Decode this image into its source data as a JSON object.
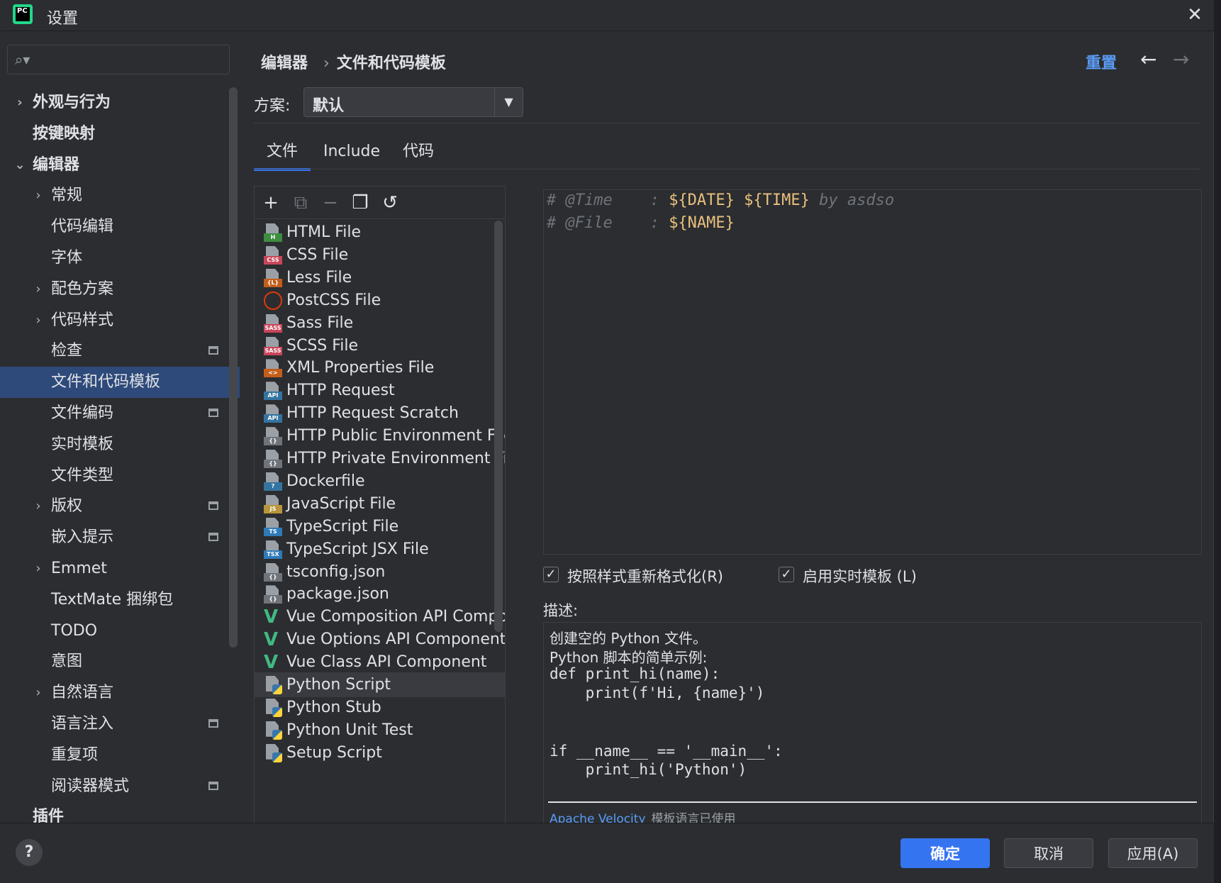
{
  "window": {
    "title": "设置",
    "logo_text": "PC"
  },
  "sidebar": {
    "items": [
      {
        "label": "外观与行为",
        "chevron": "›",
        "level": 0,
        "bold": true
      },
      {
        "label": "按键映射",
        "chevron": "",
        "level": 0,
        "bold": true
      },
      {
        "label": "编辑器",
        "chevron": "⌄",
        "level": 0,
        "bold": true
      },
      {
        "label": "常规",
        "chevron": "›",
        "level": 1
      },
      {
        "label": "代码编辑",
        "chevron": "",
        "level": 1
      },
      {
        "label": "字体",
        "chevron": "",
        "level": 1
      },
      {
        "label": "配色方案",
        "chevron": "›",
        "level": 1
      },
      {
        "label": "代码样式",
        "chevron": "›",
        "level": 1
      },
      {
        "label": "检查",
        "chevron": "",
        "level": 1,
        "proj": true
      },
      {
        "label": "文件和代码模板",
        "chevron": "",
        "level": 1,
        "selected": true
      },
      {
        "label": "文件编码",
        "chevron": "",
        "level": 1,
        "proj": true
      },
      {
        "label": "实时模板",
        "chevron": "",
        "level": 1
      },
      {
        "label": "文件类型",
        "chevron": "",
        "level": 1
      },
      {
        "label": "版权",
        "chevron": "›",
        "level": 1,
        "proj": true
      },
      {
        "label": "嵌入提示",
        "chevron": "",
        "level": 1,
        "proj": true
      },
      {
        "label": "Emmet",
        "chevron": "›",
        "level": 1
      },
      {
        "label": "TextMate 捆绑包",
        "chevron": "",
        "level": 1
      },
      {
        "label": "TODO",
        "chevron": "",
        "level": 1
      },
      {
        "label": "意图",
        "chevron": "",
        "level": 1
      },
      {
        "label": "自然语言",
        "chevron": "›",
        "level": 1
      },
      {
        "label": "语言注入",
        "chevron": "",
        "level": 1,
        "proj": true
      },
      {
        "label": "重复项",
        "chevron": "",
        "level": 1
      },
      {
        "label": "阅读器模式",
        "chevron": "",
        "level": 1,
        "proj": true
      },
      {
        "label": "插件",
        "chevron": "",
        "level": 0,
        "bold": true
      }
    ]
  },
  "header": {
    "breadcrumb": [
      "编辑器",
      "文件和代码模板"
    ],
    "breadcrumb_sep": "›",
    "reset_label": "重置"
  },
  "scheme": {
    "label": "方案:",
    "value": "默认"
  },
  "tabs": [
    "文件",
    "Include",
    "代码"
  ],
  "file_templates": [
    {
      "name": "HTML File",
      "icon": "html-file-icon",
      "badge": "H",
      "color": "#3d8c40"
    },
    {
      "name": "CSS File",
      "icon": "css-file-icon",
      "badge": "CSS",
      "color": "#c9465a"
    },
    {
      "name": "Less File",
      "icon": "less-file-icon",
      "badge": "{L}",
      "color": "#c35e1b"
    },
    {
      "name": "PostCSS File",
      "icon": "postcss-file-icon",
      "badge": "",
      "color": "#dd3a0a"
    },
    {
      "name": "Sass File",
      "icon": "sass-file-icon",
      "badge": "SASS",
      "color": "#c9465a"
    },
    {
      "name": "SCSS File",
      "icon": "scss-file-icon",
      "badge": "SASS",
      "color": "#c9465a"
    },
    {
      "name": "XML Properties File",
      "icon": "xml-file-icon",
      "badge": "<>",
      "color": "#c35e1b"
    },
    {
      "name": "HTTP Request",
      "icon": "api-file-icon",
      "badge": "API",
      "color": "#3574a0"
    },
    {
      "name": "HTTP Request Scratch",
      "icon": "api-file-icon",
      "badge": "API",
      "color": "#3574a0"
    },
    {
      "name": "HTTP Public Environment File",
      "icon": "json-file-icon",
      "badge": "{}",
      "color": "#6f737a"
    },
    {
      "name": "HTTP Private Environment File",
      "icon": "json-file-icon",
      "badge": "{}",
      "color": "#6f737a"
    },
    {
      "name": "Dockerfile",
      "icon": "dockerfile-icon",
      "badge": "?",
      "color": "#3574a0"
    },
    {
      "name": "JavaScript File",
      "icon": "js-file-icon",
      "badge": "JS",
      "color": "#b8953a"
    },
    {
      "name": "TypeScript File",
      "icon": "ts-file-icon",
      "badge": "TS",
      "color": "#2f7ab8"
    },
    {
      "name": "TypeScript JSX File",
      "icon": "tsx-file-icon",
      "badge": "TSX",
      "color": "#2f7ab8"
    },
    {
      "name": "tsconfig.json",
      "icon": "json-file-icon",
      "badge": "{}",
      "color": "#6f737a"
    },
    {
      "name": "package.json",
      "icon": "json-file-icon",
      "badge": "{}",
      "color": "#6f737a"
    },
    {
      "name": "Vue Composition API Component",
      "icon": "vue-icon",
      "badge": "V",
      "color": "#42b883"
    },
    {
      "name": "Vue Options API Component",
      "icon": "vue-icon",
      "badge": "V",
      "color": "#42b883"
    },
    {
      "name": "Vue Class API Component",
      "icon": "vue-icon",
      "badge": "V",
      "color": "#42b883"
    },
    {
      "name": "Python Script",
      "icon": "python-file-icon",
      "badge": "",
      "color": "#3776ab",
      "selected": true
    },
    {
      "name": "Python Stub",
      "icon": "python-file-icon",
      "badge": "",
      "color": "#3776ab"
    },
    {
      "name": "Python Unit Test",
      "icon": "python-file-icon",
      "badge": "",
      "color": "#3776ab"
    },
    {
      "name": "Setup Script",
      "icon": "python-file-icon",
      "badge": "",
      "color": "#3776ab"
    }
  ],
  "editor": {
    "lines": [
      {
        "comment": "# @Time    : ",
        "vars": "${DATE} ${TIME}",
        "tail": " by asdso"
      },
      {
        "comment": "# @File    : ",
        "vars": "${NAME}",
        "tail": ""
      }
    ]
  },
  "options": {
    "reformat_label": "按照样式重新格式化(R)",
    "live_template_label": "启用实时模板 (L)",
    "checkmark": "✓"
  },
  "description": {
    "label": "描述:",
    "lines": [
      "创建空的 Python 文件。",
      "Python 脚本的简单示例:",
      "def print_hi(name):",
      "    print(f'Hi, {name}')",
      "",
      "",
      "if __name__ == '__main__':",
      "    print_hi('Python')"
    ],
    "footer_link": "Apache Velocity",
    "footer_text": "模板语言已使用"
  },
  "buttons": {
    "help": "?",
    "ok": "确定",
    "cancel": "取消",
    "apply": "应用(A)"
  },
  "colors": {
    "accent": "#3574f0",
    "link": "#5a9cf5",
    "selection": "#2e4a7a",
    "template_var": "#e8c07d"
  }
}
